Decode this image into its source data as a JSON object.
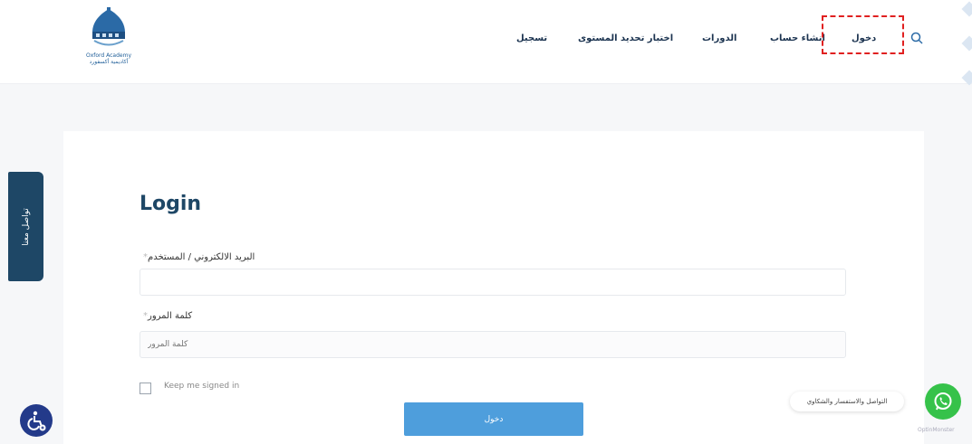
{
  "header": {
    "logo_text": "Oxford Academy",
    "logo_subtext": "أكاديمية أكسفورد",
    "nav": {
      "login": "دخول",
      "create_account": "انشاء حساب",
      "courses": "الدورات",
      "placement_test": "اختبار تحديد المستوى",
      "register": "تسجيل"
    }
  },
  "side_tab": {
    "label": "تواصل معنا"
  },
  "form": {
    "title": "Login",
    "email_label": "البريد الالكتروني / المستخدم",
    "password_label": "كلمة المرور",
    "password_placeholder": "كلمة المرور",
    "required_mark": "*",
    "remember_label": "Keep me signed in",
    "submit_label": "دخول"
  },
  "chat": {
    "bubble_text": "التواصل والاستفسار والشكاوي",
    "brand": "OptinMonster"
  },
  "colors": {
    "primary": "#1e4766",
    "button": "#4e9edc",
    "whatsapp": "#36c24a",
    "highlight": "#e02020"
  }
}
